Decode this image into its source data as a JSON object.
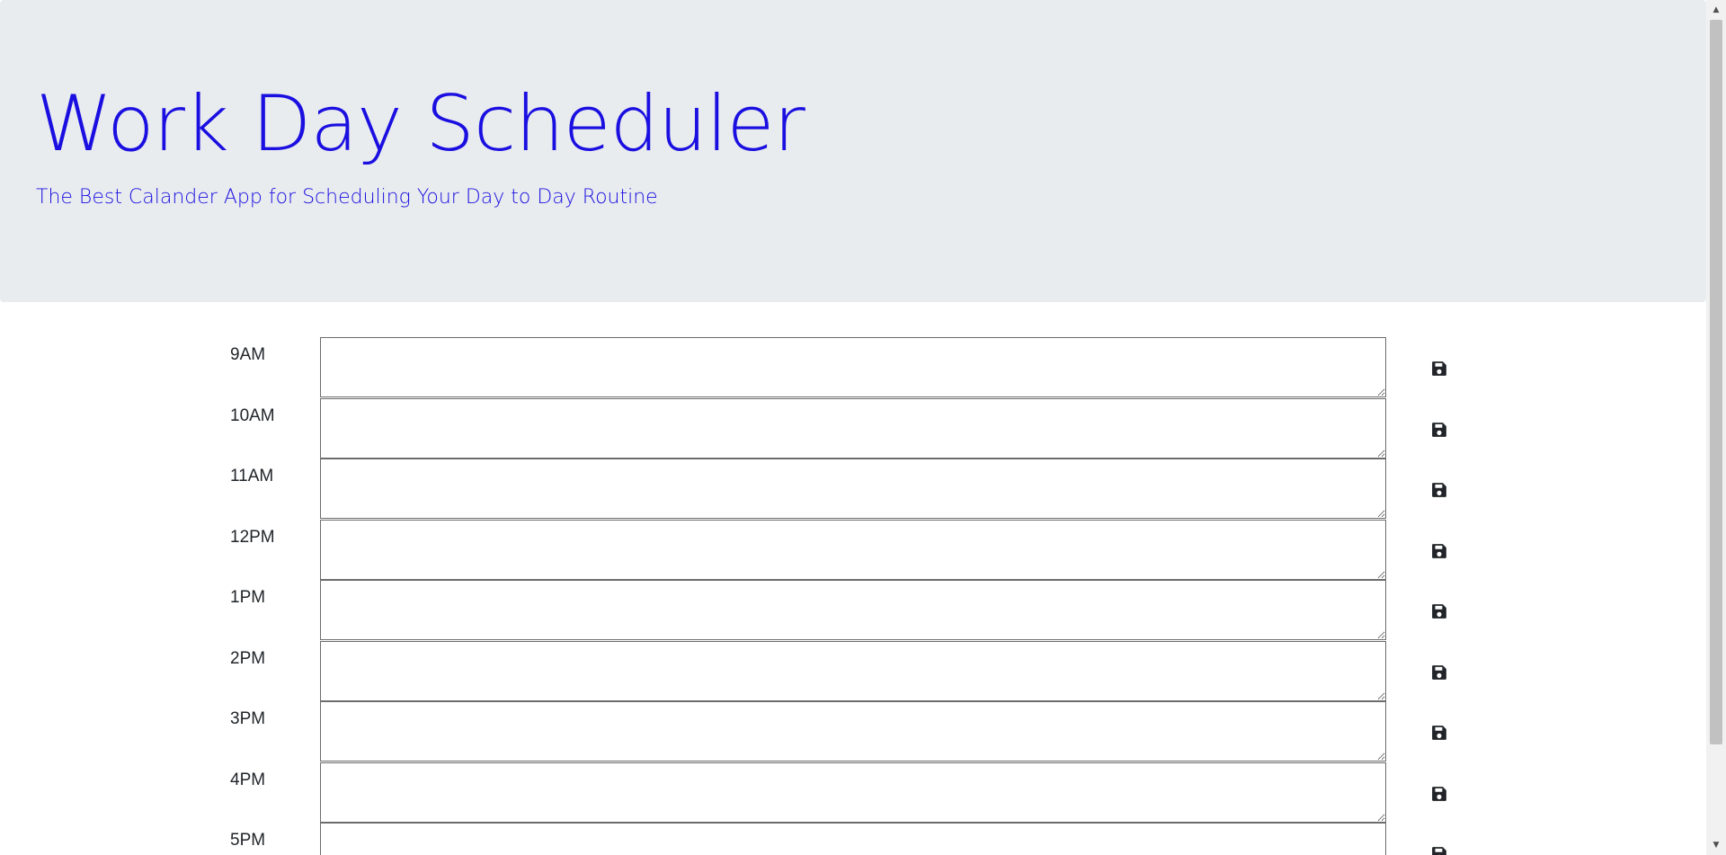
{
  "header": {
    "title": "Work Day Scheduler",
    "lead": "The Best Calander App for Scheduling Your Day to Day Routine"
  },
  "colors": {
    "header_background": "#e9ecef",
    "header_text": "#1a0fe0",
    "save_icon": "#212529"
  },
  "schedule": {
    "rows": [
      {
        "hour": "9AM",
        "text": "",
        "icon": "save-icon"
      },
      {
        "hour": "10AM",
        "text": "",
        "icon": "save-icon"
      },
      {
        "hour": "11AM",
        "text": "",
        "icon": "save-icon"
      },
      {
        "hour": "12PM",
        "text": "",
        "icon": "save-icon"
      },
      {
        "hour": "1PM",
        "text": "",
        "icon": "save-icon"
      },
      {
        "hour": "2PM",
        "text": "",
        "icon": "save-icon"
      },
      {
        "hour": "3PM",
        "text": "",
        "icon": "save-icon"
      },
      {
        "hour": "4PM",
        "text": "",
        "icon": "save-icon"
      },
      {
        "hour": "5PM",
        "text": "",
        "icon": "save-icon"
      }
    ]
  }
}
